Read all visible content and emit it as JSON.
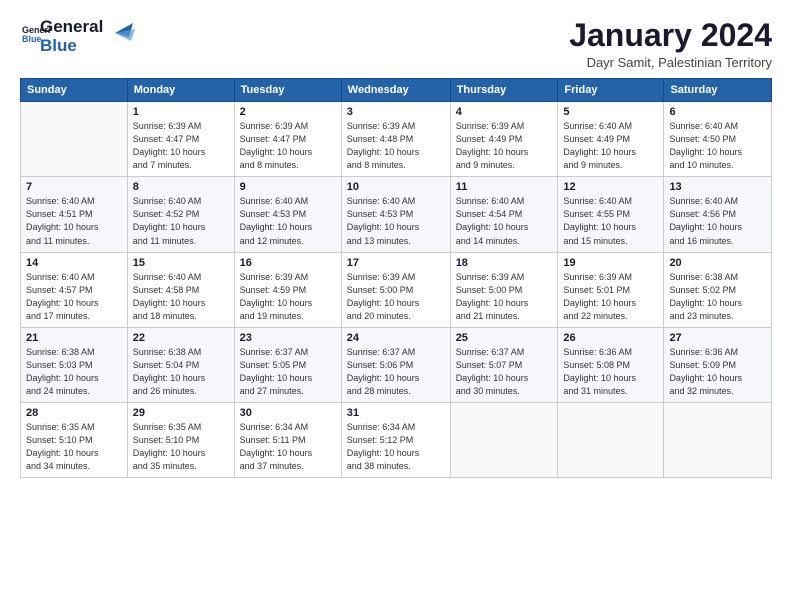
{
  "logo": {
    "line1": "General",
    "line2": "Blue"
  },
  "title": "January 2024",
  "subtitle": "Dayr Samit, Palestinian Territory",
  "days_header": [
    "Sunday",
    "Monday",
    "Tuesday",
    "Wednesday",
    "Thursday",
    "Friday",
    "Saturday"
  ],
  "weeks": [
    [
      {
        "num": "",
        "info": ""
      },
      {
        "num": "1",
        "info": "Sunrise: 6:39 AM\nSunset: 4:47 PM\nDaylight: 10 hours\nand 7 minutes."
      },
      {
        "num": "2",
        "info": "Sunrise: 6:39 AM\nSunset: 4:47 PM\nDaylight: 10 hours\nand 8 minutes."
      },
      {
        "num": "3",
        "info": "Sunrise: 6:39 AM\nSunset: 4:48 PM\nDaylight: 10 hours\nand 8 minutes."
      },
      {
        "num": "4",
        "info": "Sunrise: 6:39 AM\nSunset: 4:49 PM\nDaylight: 10 hours\nand 9 minutes."
      },
      {
        "num": "5",
        "info": "Sunrise: 6:40 AM\nSunset: 4:49 PM\nDaylight: 10 hours\nand 9 minutes."
      },
      {
        "num": "6",
        "info": "Sunrise: 6:40 AM\nSunset: 4:50 PM\nDaylight: 10 hours\nand 10 minutes."
      }
    ],
    [
      {
        "num": "7",
        "info": "Sunrise: 6:40 AM\nSunset: 4:51 PM\nDaylight: 10 hours\nand 11 minutes."
      },
      {
        "num": "8",
        "info": "Sunrise: 6:40 AM\nSunset: 4:52 PM\nDaylight: 10 hours\nand 11 minutes."
      },
      {
        "num": "9",
        "info": "Sunrise: 6:40 AM\nSunset: 4:53 PM\nDaylight: 10 hours\nand 12 minutes."
      },
      {
        "num": "10",
        "info": "Sunrise: 6:40 AM\nSunset: 4:53 PM\nDaylight: 10 hours\nand 13 minutes."
      },
      {
        "num": "11",
        "info": "Sunrise: 6:40 AM\nSunset: 4:54 PM\nDaylight: 10 hours\nand 14 minutes."
      },
      {
        "num": "12",
        "info": "Sunrise: 6:40 AM\nSunset: 4:55 PM\nDaylight: 10 hours\nand 15 minutes."
      },
      {
        "num": "13",
        "info": "Sunrise: 6:40 AM\nSunset: 4:56 PM\nDaylight: 10 hours\nand 16 minutes."
      }
    ],
    [
      {
        "num": "14",
        "info": "Sunrise: 6:40 AM\nSunset: 4:57 PM\nDaylight: 10 hours\nand 17 minutes."
      },
      {
        "num": "15",
        "info": "Sunrise: 6:40 AM\nSunset: 4:58 PM\nDaylight: 10 hours\nand 18 minutes."
      },
      {
        "num": "16",
        "info": "Sunrise: 6:39 AM\nSunset: 4:59 PM\nDaylight: 10 hours\nand 19 minutes."
      },
      {
        "num": "17",
        "info": "Sunrise: 6:39 AM\nSunset: 5:00 PM\nDaylight: 10 hours\nand 20 minutes."
      },
      {
        "num": "18",
        "info": "Sunrise: 6:39 AM\nSunset: 5:00 PM\nDaylight: 10 hours\nand 21 minutes."
      },
      {
        "num": "19",
        "info": "Sunrise: 6:39 AM\nSunset: 5:01 PM\nDaylight: 10 hours\nand 22 minutes."
      },
      {
        "num": "20",
        "info": "Sunrise: 6:38 AM\nSunset: 5:02 PM\nDaylight: 10 hours\nand 23 minutes."
      }
    ],
    [
      {
        "num": "21",
        "info": "Sunrise: 6:38 AM\nSunset: 5:03 PM\nDaylight: 10 hours\nand 24 minutes."
      },
      {
        "num": "22",
        "info": "Sunrise: 6:38 AM\nSunset: 5:04 PM\nDaylight: 10 hours\nand 26 minutes."
      },
      {
        "num": "23",
        "info": "Sunrise: 6:37 AM\nSunset: 5:05 PM\nDaylight: 10 hours\nand 27 minutes."
      },
      {
        "num": "24",
        "info": "Sunrise: 6:37 AM\nSunset: 5:06 PM\nDaylight: 10 hours\nand 28 minutes."
      },
      {
        "num": "25",
        "info": "Sunrise: 6:37 AM\nSunset: 5:07 PM\nDaylight: 10 hours\nand 30 minutes."
      },
      {
        "num": "26",
        "info": "Sunrise: 6:36 AM\nSunset: 5:08 PM\nDaylight: 10 hours\nand 31 minutes."
      },
      {
        "num": "27",
        "info": "Sunrise: 6:36 AM\nSunset: 5:09 PM\nDaylight: 10 hours\nand 32 minutes."
      }
    ],
    [
      {
        "num": "28",
        "info": "Sunrise: 6:35 AM\nSunset: 5:10 PM\nDaylight: 10 hours\nand 34 minutes."
      },
      {
        "num": "29",
        "info": "Sunrise: 6:35 AM\nSunset: 5:10 PM\nDaylight: 10 hours\nand 35 minutes."
      },
      {
        "num": "30",
        "info": "Sunrise: 6:34 AM\nSunset: 5:11 PM\nDaylight: 10 hours\nand 37 minutes."
      },
      {
        "num": "31",
        "info": "Sunrise: 6:34 AM\nSunset: 5:12 PM\nDaylight: 10 hours\nand 38 minutes."
      },
      {
        "num": "",
        "info": ""
      },
      {
        "num": "",
        "info": ""
      },
      {
        "num": "",
        "info": ""
      }
    ]
  ]
}
